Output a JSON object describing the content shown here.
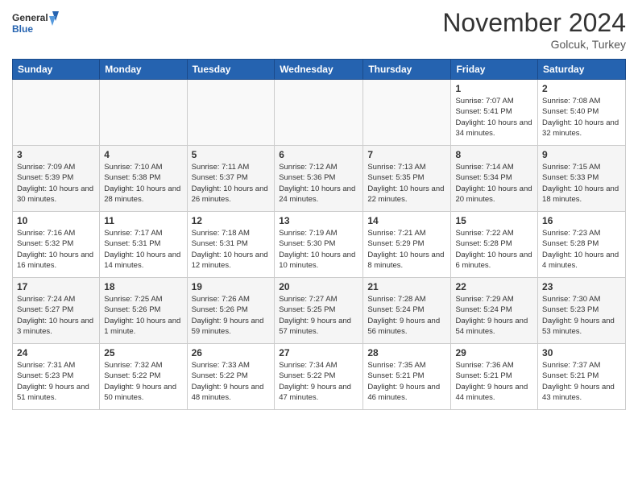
{
  "header": {
    "logo_general": "General",
    "logo_blue": "Blue",
    "month_title": "November 2024",
    "location": "Golcuk, Turkey"
  },
  "days_of_week": [
    "Sunday",
    "Monday",
    "Tuesday",
    "Wednesday",
    "Thursday",
    "Friday",
    "Saturday"
  ],
  "weeks": [
    [
      {
        "day": "",
        "empty": true
      },
      {
        "day": "",
        "empty": true
      },
      {
        "day": "",
        "empty": true
      },
      {
        "day": "",
        "empty": true
      },
      {
        "day": "",
        "empty": true
      },
      {
        "day": "1",
        "sunrise": "7:07 AM",
        "sunset": "5:41 PM",
        "daylight": "10 hours and 34 minutes."
      },
      {
        "day": "2",
        "sunrise": "7:08 AM",
        "sunset": "5:40 PM",
        "daylight": "10 hours and 32 minutes."
      }
    ],
    [
      {
        "day": "3",
        "sunrise": "7:09 AM",
        "sunset": "5:39 PM",
        "daylight": "10 hours and 30 minutes."
      },
      {
        "day": "4",
        "sunrise": "7:10 AM",
        "sunset": "5:38 PM",
        "daylight": "10 hours and 28 minutes."
      },
      {
        "day": "5",
        "sunrise": "7:11 AM",
        "sunset": "5:37 PM",
        "daylight": "10 hours and 26 minutes."
      },
      {
        "day": "6",
        "sunrise": "7:12 AM",
        "sunset": "5:36 PM",
        "daylight": "10 hours and 24 minutes."
      },
      {
        "day": "7",
        "sunrise": "7:13 AM",
        "sunset": "5:35 PM",
        "daylight": "10 hours and 22 minutes."
      },
      {
        "day": "8",
        "sunrise": "7:14 AM",
        "sunset": "5:34 PM",
        "daylight": "10 hours and 20 minutes."
      },
      {
        "day": "9",
        "sunrise": "7:15 AM",
        "sunset": "5:33 PM",
        "daylight": "10 hours and 18 minutes."
      }
    ],
    [
      {
        "day": "10",
        "sunrise": "7:16 AM",
        "sunset": "5:32 PM",
        "daylight": "10 hours and 16 minutes."
      },
      {
        "day": "11",
        "sunrise": "7:17 AM",
        "sunset": "5:31 PM",
        "daylight": "10 hours and 14 minutes."
      },
      {
        "day": "12",
        "sunrise": "7:18 AM",
        "sunset": "5:31 PM",
        "daylight": "10 hours and 12 minutes."
      },
      {
        "day": "13",
        "sunrise": "7:19 AM",
        "sunset": "5:30 PM",
        "daylight": "10 hours and 10 minutes."
      },
      {
        "day": "14",
        "sunrise": "7:21 AM",
        "sunset": "5:29 PM",
        "daylight": "10 hours and 8 minutes."
      },
      {
        "day": "15",
        "sunrise": "7:22 AM",
        "sunset": "5:28 PM",
        "daylight": "10 hours and 6 minutes."
      },
      {
        "day": "16",
        "sunrise": "7:23 AM",
        "sunset": "5:28 PM",
        "daylight": "10 hours and 4 minutes."
      }
    ],
    [
      {
        "day": "17",
        "sunrise": "7:24 AM",
        "sunset": "5:27 PM",
        "daylight": "10 hours and 3 minutes."
      },
      {
        "day": "18",
        "sunrise": "7:25 AM",
        "sunset": "5:26 PM",
        "daylight": "10 hours and 1 minute."
      },
      {
        "day": "19",
        "sunrise": "7:26 AM",
        "sunset": "5:26 PM",
        "daylight": "9 hours and 59 minutes."
      },
      {
        "day": "20",
        "sunrise": "7:27 AM",
        "sunset": "5:25 PM",
        "daylight": "9 hours and 57 minutes."
      },
      {
        "day": "21",
        "sunrise": "7:28 AM",
        "sunset": "5:24 PM",
        "daylight": "9 hours and 56 minutes."
      },
      {
        "day": "22",
        "sunrise": "7:29 AM",
        "sunset": "5:24 PM",
        "daylight": "9 hours and 54 minutes."
      },
      {
        "day": "23",
        "sunrise": "7:30 AM",
        "sunset": "5:23 PM",
        "daylight": "9 hours and 53 minutes."
      }
    ],
    [
      {
        "day": "24",
        "sunrise": "7:31 AM",
        "sunset": "5:23 PM",
        "daylight": "9 hours and 51 minutes."
      },
      {
        "day": "25",
        "sunrise": "7:32 AM",
        "sunset": "5:22 PM",
        "daylight": "9 hours and 50 minutes."
      },
      {
        "day": "26",
        "sunrise": "7:33 AM",
        "sunset": "5:22 PM",
        "daylight": "9 hours and 48 minutes."
      },
      {
        "day": "27",
        "sunrise": "7:34 AM",
        "sunset": "5:22 PM",
        "daylight": "9 hours and 47 minutes."
      },
      {
        "day": "28",
        "sunrise": "7:35 AM",
        "sunset": "5:21 PM",
        "daylight": "9 hours and 46 minutes."
      },
      {
        "day": "29",
        "sunrise": "7:36 AM",
        "sunset": "5:21 PM",
        "daylight": "9 hours and 44 minutes."
      },
      {
        "day": "30",
        "sunrise": "7:37 AM",
        "sunset": "5:21 PM",
        "daylight": "9 hours and 43 minutes."
      }
    ]
  ]
}
